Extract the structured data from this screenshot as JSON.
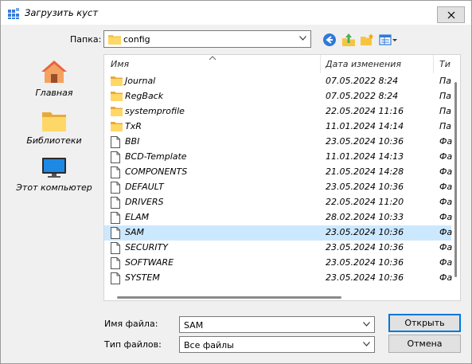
{
  "window": {
    "title": "Загрузить куст"
  },
  "toolbar": {
    "lookin_label": "Папка:",
    "lookin_value": "config"
  },
  "places": [
    {
      "label": "Главная",
      "icon": "home-icon"
    },
    {
      "label": "Библиотеки",
      "icon": "libraries-icon"
    },
    {
      "label": "Этот компьютер",
      "icon": "computer-icon"
    }
  ],
  "columns": {
    "name": "Имя",
    "date": "Дата изменения",
    "type": "Ти"
  },
  "files": [
    {
      "name": "Journal",
      "date": "07.05.2022 8:24",
      "type": "Па",
      "kind": "folder"
    },
    {
      "name": "RegBack",
      "date": "07.05.2022 8:24",
      "type": "Па",
      "kind": "folder"
    },
    {
      "name": "systemprofile",
      "date": "22.05.2024 11:16",
      "type": "Па",
      "kind": "folder"
    },
    {
      "name": "TxR",
      "date": "11.01.2024 14:14",
      "type": "Па",
      "kind": "folder"
    },
    {
      "name": "BBI",
      "date": "23.05.2024 10:36",
      "type": "Фа",
      "kind": "file"
    },
    {
      "name": "BCD-Template",
      "date": "11.01.2024 14:13",
      "type": "Фа",
      "kind": "file"
    },
    {
      "name": "COMPONENTS",
      "date": "21.05.2024 14:28",
      "type": "Фа",
      "kind": "file"
    },
    {
      "name": "DEFAULT",
      "date": "23.05.2024 10:36",
      "type": "Фа",
      "kind": "file"
    },
    {
      "name": "DRIVERS",
      "date": "22.05.2024 11:20",
      "type": "Фа",
      "kind": "file"
    },
    {
      "name": "ELAM",
      "date": "28.02.2024 10:33",
      "type": "Фа",
      "kind": "file"
    },
    {
      "name": "SAM",
      "date": "23.05.2024 10:36",
      "type": "Фа",
      "kind": "file",
      "selected": true
    },
    {
      "name": "SECURITY",
      "date": "23.05.2024 10:36",
      "type": "Фа",
      "kind": "file"
    },
    {
      "name": "SOFTWARE",
      "date": "23.05.2024 10:36",
      "type": "Фа",
      "kind": "file"
    },
    {
      "name": "SYSTEM",
      "date": "23.05.2024 10:36",
      "type": "Фа",
      "kind": "file"
    }
  ],
  "filename": {
    "label": "Имя файла:",
    "value": "SAM"
  },
  "filetype": {
    "label": "Тип файлов:",
    "value": "Все файлы"
  },
  "buttons": {
    "open": "Открыть",
    "cancel": "Отмена"
  },
  "colors": {
    "selection": "#cce8ff",
    "folder": "#f5c542",
    "accent": "#0078d7"
  }
}
